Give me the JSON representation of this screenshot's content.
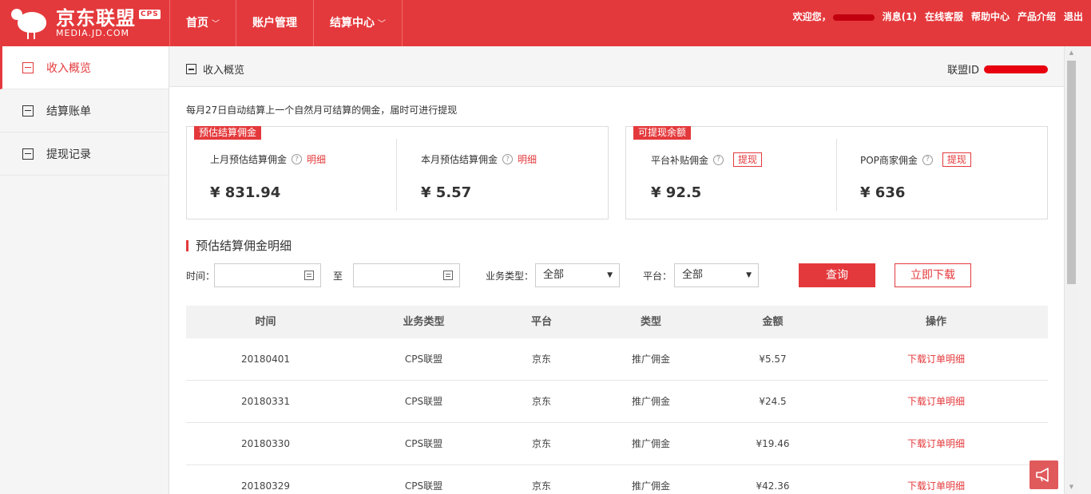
{
  "brand": {
    "name": "京东联盟",
    "badge": "CPS",
    "domain": "MEDIA.JD.COM"
  },
  "nav": [
    {
      "label": "首页",
      "has_chevron": true
    },
    {
      "label": "账户管理",
      "has_chevron": false
    },
    {
      "label": "结算中心",
      "has_chevron": true
    }
  ],
  "top_links": {
    "welcome": "欢迎您，",
    "messages": "消息(1)",
    "service": "在线客服",
    "help": "帮助中心",
    "product": "产品介绍",
    "logout": "退出"
  },
  "sidebar": [
    {
      "label": "收入概览",
      "icon": "income-icon",
      "active": true
    },
    {
      "label": "结算账单",
      "icon": "bill-icon",
      "active": false
    },
    {
      "label": "提现记录",
      "icon": "withdraw-record-icon",
      "active": false
    }
  ],
  "breadcrumb": {
    "title": "收入概览",
    "union_id_label": "联盟ID"
  },
  "notice": "每月27日自动结算上一个自然月可结算的佣金，届时可进行提现",
  "estimated_panel": {
    "tag": "预估结算佣金",
    "last_month": {
      "label": "上月预估结算佣金",
      "link": "明细",
      "value": "¥ 831.94"
    },
    "this_month": {
      "label": "本月预估结算佣金",
      "link": "明细",
      "value": "¥ 5.57"
    }
  },
  "withdraw_panel": {
    "tag": "可提现余额",
    "platform": {
      "label": "平台补贴佣金",
      "button": "提现",
      "value": "¥ 92.5"
    },
    "pop": {
      "label": "POP商家佣金",
      "button": "提现",
      "value": "¥ 636"
    }
  },
  "section_title": "预估结算佣金明细",
  "filters": {
    "time_label": "时间：",
    "to_label": "至",
    "biz_label": "业务类型：",
    "biz_value": "全部",
    "platform_label": "平台：",
    "platform_value": "全部",
    "query": "查询",
    "download": "立即下载"
  },
  "table": {
    "headers": [
      "时间",
      "业务类型",
      "平台",
      "类型",
      "金额",
      "操作"
    ],
    "rows": [
      [
        "20180401",
        "CPS联盟",
        "京东",
        "推广佣金",
        "¥5.57",
        "下载订单明细"
      ],
      [
        "20180331",
        "CPS联盟",
        "京东",
        "推广佣金",
        "¥24.5",
        "下载订单明细"
      ],
      [
        "20180330",
        "CPS联盟",
        "京东",
        "推广佣金",
        "¥19.46",
        "下载订单明细"
      ],
      [
        "20180329",
        "CPS联盟",
        "京东",
        "推广佣金",
        "¥42.36",
        "下载订单明细"
      ]
    ]
  },
  "colors": {
    "brand_red": "#e4393c",
    "text": "#333333"
  }
}
